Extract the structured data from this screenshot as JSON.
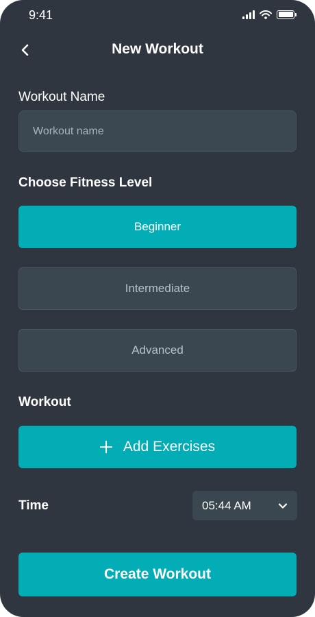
{
  "status_bar": {
    "time": "9:41"
  },
  "header": {
    "back_icon": "chevron-left-icon",
    "title": "New Workout"
  },
  "workout_name": {
    "label": "Workout Name",
    "placeholder": "Workout name",
    "value": ""
  },
  "fitness_level": {
    "label": "Choose Fitness Level",
    "options": [
      {
        "label": "Beginner",
        "selected": true
      },
      {
        "label": "Intermediate",
        "selected": false
      },
      {
        "label": "Advanced",
        "selected": false
      }
    ]
  },
  "workout": {
    "label": "Workout",
    "add_button_label": "Add Exercises",
    "add_icon": "plus-icon"
  },
  "time": {
    "label": "Time",
    "value": "05:44 AM",
    "dropdown_icon": "chevron-down-icon"
  },
  "create_button_label": "Create Workout",
  "colors": {
    "background": "#2f3640",
    "accent": "#02adb5",
    "field": "#3b4750"
  }
}
